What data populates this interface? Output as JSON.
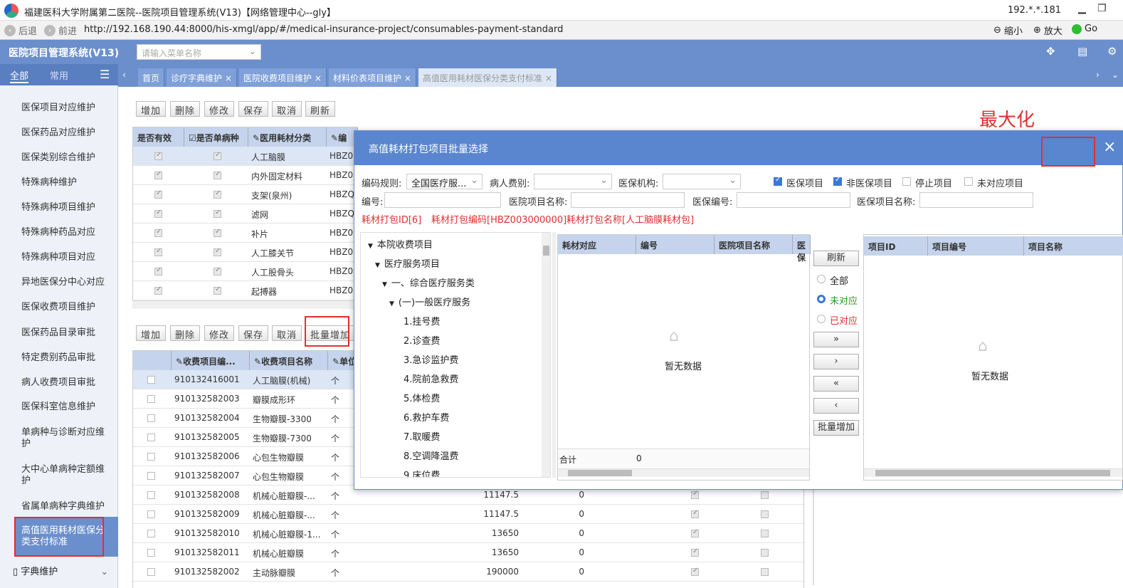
{
  "window": {
    "title": "福建医科大学附属第二医院--医院项目管理系统(V13)【网络管理中心--gly】",
    "ip": "192.*.*.181"
  },
  "browser": {
    "back": "后退",
    "forward": "前进",
    "url": "http://192.168.190.44:8000/his-xmgl/app/#/medical-insurance-project/consumables-payment-standard",
    "zoom_out": "缩小",
    "zoom_in": "放大",
    "go": "Go"
  },
  "app": {
    "title": "医院项目管理系统(V13)",
    "menu_placeholder": "请输入菜单名称"
  },
  "sidebar": {
    "tab_all": "全部",
    "tab_common": "常用",
    "items": [
      "医保项目对应维护",
      "医保药品对应维护",
      "医保类别综合维护",
      "特殊病种维护",
      "特殊病种项目维护",
      "特殊病种药品对应",
      "特殊病种项目对应",
      "异地医保分中心对应",
      "医保收费项目维护",
      "医保药品目录审批",
      "特定费别药品审批",
      "病人收费项目审批",
      "医保科室信息维护",
      "单病种与诊断对应维护",
      "大中心单病种定额维护",
      "省属单病种字典维护",
      "高值医用耗材医保分类支付标准"
    ],
    "footer": "字典维护"
  },
  "tabs": [
    "首页",
    "诊疗字典维护",
    "医院收费项目维护",
    "材料价表项目维护",
    "高值医用耗材医保分类支付标准"
  ],
  "toolbar1": [
    "增加",
    "删除",
    "修改",
    "保存",
    "取消",
    "刷新"
  ],
  "toolbar2": [
    "增加",
    "删除",
    "修改",
    "保存",
    "取消",
    "批量增加"
  ],
  "grid1": {
    "headers": [
      "是否有效",
      "是否单病种",
      "医用耗材分类",
      "编"
    ],
    "rows": [
      [
        "人工脑膜",
        "HBZ0"
      ],
      [
        "内外固定材料",
        "HBZ0"
      ],
      [
        "支架(泉州)",
        "HBZQ"
      ],
      [
        "滤网",
        "HBZQ"
      ],
      [
        "补片",
        "HBZ0"
      ],
      [
        "人工膝关节",
        "HBZ0"
      ],
      [
        "人工股骨头",
        "HBZ0"
      ],
      [
        "起搏器",
        "HBZ0"
      ]
    ]
  },
  "grid2": {
    "headers": [
      "收费项目编...",
      "收费项目名称",
      "单位"
    ],
    "rows": [
      {
        "code": "910132416001",
        "name": "人工脑膜(机械)",
        "unit": "个",
        "price": "",
        "n": ""
      },
      {
        "code": "910132582003",
        "name": "瓣膜成形环",
        "unit": "个",
        "price": "",
        "n": ""
      },
      {
        "code": "910132582004",
        "name": "生物瓣膜-3300",
        "unit": "个",
        "price": "",
        "n": ""
      },
      {
        "code": "910132582005",
        "name": "生物瓣膜-7300",
        "unit": "个",
        "price": "",
        "n": ""
      },
      {
        "code": "910132582006",
        "name": "心包生物瓣膜",
        "unit": "个",
        "price": "",
        "n": ""
      },
      {
        "code": "910132582007",
        "name": "心包生物瓣膜",
        "unit": "个",
        "price": "",
        "n": ""
      },
      {
        "code": "910132582008",
        "name": "机械心脏瓣膜-...",
        "unit": "个",
        "price": "11147.5",
        "n": "0"
      },
      {
        "code": "910132582009",
        "name": "机械心脏瓣膜-...",
        "unit": "个",
        "price": "11147.5",
        "n": "0"
      },
      {
        "code": "910132582010",
        "name": "机械心脏瓣膜-1...",
        "unit": "个",
        "price": "13650",
        "n": "0"
      },
      {
        "code": "910132582011",
        "name": "机械心脏瓣膜",
        "unit": "个",
        "price": "13650",
        "n": "0"
      },
      {
        "code": "910132582002",
        "name": "主动脉瓣膜",
        "unit": "个",
        "price": "190000",
        "n": "0"
      }
    ]
  },
  "annotation": "最大化",
  "dialog": {
    "title": "高值耗材打包项目批量选择",
    "labels": {
      "code_rule": "编码规则:",
      "patient_fee": "病人费别:",
      "insurance_org": "医保机构:",
      "code": "编号:",
      "hosp_name": "医院项目名称:",
      "ins_code": "医保编号:",
      "ins_name": "医保项目名称:"
    },
    "code_rule_value": "全国医疗服...",
    "checks": [
      {
        "label": "医保项目",
        "on": true
      },
      {
        "label": "非医保项目",
        "on": true
      },
      {
        "label": "停止项目",
        "on": false
      },
      {
        "label": "未对应项目",
        "on": false
      }
    ],
    "info": [
      "耗材打包ID[6]",
      "耗材打包编码[HBZ003000000]",
      "耗材打包名称[人工脑膜耗材包]"
    ],
    "tree": [
      "本院收费项目",
      "医疗服务项目",
      "一、综合医疗服务类",
      "(一)一般医疗服务",
      "1.挂号费",
      "2.诊查费",
      "3.急诊监护费",
      "4.院前急救费",
      "5.体检费",
      "6.救护车费",
      "7.取暖费",
      "8.空调降温费",
      "9.床位费"
    ],
    "mid_headers": [
      "耗材对应",
      "编号",
      "医院项目名称",
      "医保"
    ],
    "empty": "暂无数据",
    "total_label": "合计",
    "total_value": "0",
    "refresh": "刷新",
    "radios": [
      {
        "label": "全部",
        "on": false,
        "color": "#333333"
      },
      {
        "label": "未对应",
        "on": true,
        "color": "#2a9a2a"
      },
      {
        "label": "已对应",
        "on": false,
        "color": "#e03030"
      }
    ],
    "move": [
      "»",
      "›",
      "«",
      "‹"
    ],
    "batch_add": "批量增加",
    "right_headers": [
      "项目ID",
      "项目编号",
      "项目名称"
    ]
  }
}
